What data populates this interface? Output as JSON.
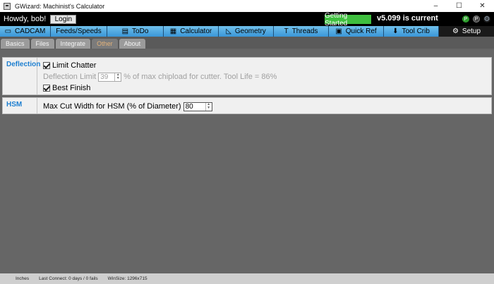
{
  "window": {
    "title": "GWizard: Machinist's Calculator",
    "controls": {
      "minimize": "–",
      "maximize": "☐",
      "close": "✕"
    }
  },
  "header": {
    "greeting": "Howdy, bob!",
    "login_label": "Login",
    "getting_started_label": "Getting Started",
    "version_text": "v5.099 is current",
    "icons": [
      "p-circle-icon",
      "paypal-icon",
      "gear-icon"
    ],
    "accent_color": "#3fbf3f"
  },
  "nav": {
    "tabs": [
      {
        "label": "CADCAM",
        "icon": "cadcam-icon"
      },
      {
        "label": "Feeds/Speeds",
        "icon": ""
      },
      {
        "label": "ToDo",
        "icon": "todo-icon"
      },
      {
        "label": "Calculator",
        "icon": "calculator-icon"
      },
      {
        "label": "Geometry",
        "icon": "geometry-icon"
      },
      {
        "label": "Threads",
        "icon": "threads-icon"
      },
      {
        "label": "Quick Ref",
        "icon": "quick-ref-icon"
      },
      {
        "label": "Tool Crib",
        "icon": "tool-crib-icon"
      },
      {
        "label": "Setup",
        "icon": "setup-gear-icon"
      }
    ],
    "active": "Setup"
  },
  "subnav": {
    "tabs": [
      "Basics",
      "Files",
      "Integrate",
      "Other",
      "About"
    ],
    "active": "Other"
  },
  "deflection": {
    "label": "Deflection",
    "limit_chatter_label": "Limit Chatter",
    "limit_chatter_checked": true,
    "deflection_limit_label": "Deflection Limit",
    "deflection_limit_value": "39",
    "deflection_suffix": "% of max chipload for cutter.  Tool Life =  86%",
    "best_finish_label": "Best Finish",
    "best_finish_checked": true
  },
  "hsm": {
    "label": "HSM",
    "max_cut_width_label": "Max Cut Width for HSM (% of Diameter)",
    "max_cut_width_value": "80"
  },
  "status": {
    "units": "Inches",
    "last_connect": "Last Connect: 0 days / 0 fails",
    "win_size": "WinSize: 1296x715"
  }
}
